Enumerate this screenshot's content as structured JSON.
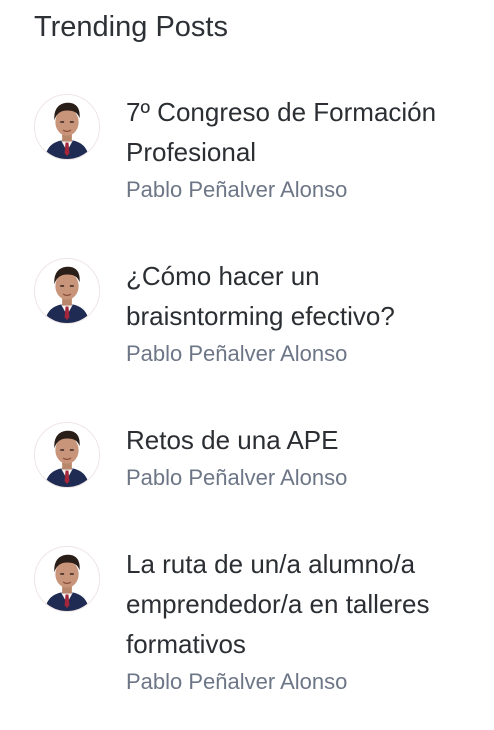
{
  "widget": {
    "title": "Trending Posts"
  },
  "posts": [
    {
      "title": "7º Congreso de Formación Profesional",
      "author": "Pablo Peñalver Alonso",
      "avatar_icon": "author-avatar"
    },
    {
      "title": "¿Cómo hacer un braisntorming efectivo?",
      "author": "Pablo Peñalver Alonso",
      "avatar_icon": "author-avatar"
    },
    {
      "title": "Retos de una APE",
      "author": "Pablo Peñalver Alonso",
      "avatar_icon": "author-avatar"
    },
    {
      "title": "La ruta de un/a alumno/a emprendedor/a en talleres formativos",
      "author": "Pablo Peñalver Alonso",
      "avatar_icon": "author-avatar"
    }
  ],
  "colors": {
    "title_text": "#2b2f33",
    "author_text": "#6d7686",
    "background": "#ffffff"
  }
}
